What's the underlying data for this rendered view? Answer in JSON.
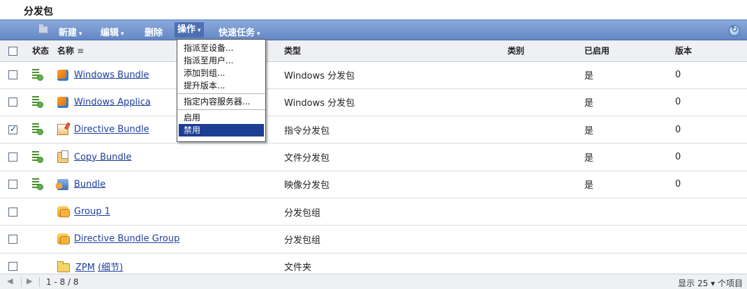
{
  "panel": {
    "title": "分发包"
  },
  "toolbar": {
    "items": [
      {
        "label": "新建",
        "caret": "▾"
      },
      {
        "label": "编辑",
        "caret": "▾"
      },
      {
        "label": "删除"
      },
      {
        "label": "操作",
        "caret": "▾"
      },
      {
        "label": "快速任务",
        "caret": "▾"
      }
    ]
  },
  "columns": {
    "status": "状态",
    "name": "名称",
    "name_sort_icon": "≡",
    "type": "类型",
    "category": "类别",
    "enabled": "已启用",
    "version": "版本"
  },
  "rows": [
    {
      "checked": false,
      "has_status": true,
      "icon": "windows-bundle-icon",
      "name": "Windows Bundle",
      "type": "Windows 分发包",
      "enabled": "是",
      "version": "0"
    },
    {
      "checked": false,
      "has_status": true,
      "icon": "windows-bundle-icon",
      "name": "Windows Applica",
      "type": "Windows 分发包",
      "enabled": "是",
      "version": "0"
    },
    {
      "checked": true,
      "has_status": true,
      "icon": "directive-bundle-icon",
      "name": "Directive Bundle",
      "type": "指令分发包",
      "enabled": "是",
      "version": "0"
    },
    {
      "checked": false,
      "has_status": true,
      "icon": "copy-bundle-icon",
      "name": "Copy Bundle",
      "type": "文件分发包",
      "enabled": "是",
      "version": "0"
    },
    {
      "checked": false,
      "has_status": true,
      "icon": "imaging-bundle-icon",
      "name": "Bundle",
      "type": "映像分发包",
      "enabled": "是",
      "version": "0"
    },
    {
      "checked": false,
      "has_status": false,
      "icon": "bundle-group-icon",
      "name": "Group 1",
      "type": "分发包组",
      "enabled": "",
      "version": ""
    },
    {
      "checked": false,
      "has_status": false,
      "icon": "bundle-group-icon",
      "name": "Directive Bundle Group",
      "type": "分发包组",
      "enabled": "",
      "version": ""
    },
    {
      "checked": false,
      "has_status": false,
      "icon": "folder-icon",
      "name": "ZPM",
      "name_suffix": "(细节)",
      "type": "文件夹",
      "enabled": "",
      "version": ""
    }
  ],
  "action_menu": {
    "items": [
      "指派至设备...",
      "指派至用户...",
      "添加到组...",
      "提升版本...",
      "指定内容服务器...",
      "启用",
      "禁用"
    ],
    "selected": "禁用"
  },
  "footer": {
    "prev_icon": "◀",
    "next_icon": "▶",
    "range": "1 - 8 / 8",
    "show_label": "显示",
    "page_size": "25",
    "page_size_caret": "▾",
    "items_label": "个项目"
  }
}
